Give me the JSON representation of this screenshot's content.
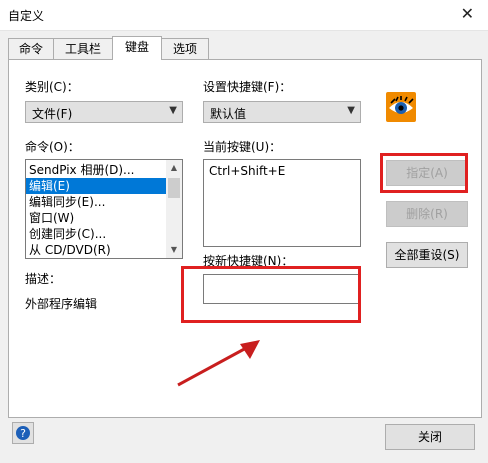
{
  "window": {
    "title": "自定义"
  },
  "tabs": [
    {
      "label": "命令"
    },
    {
      "label": "工具栏"
    },
    {
      "label": "键盘"
    },
    {
      "label": "选项"
    }
  ],
  "category": {
    "label": "类别(C)：",
    "value": "文件(F)"
  },
  "shortcut_set": {
    "label": "设置快捷键(F)：",
    "value": "默认值"
  },
  "commands": {
    "label": "命令(O)：",
    "items": [
      {
        "label": "SendPix 相册(D)..."
      },
      {
        "label": "编辑(E)"
      },
      {
        "label": "编辑同步(E)..."
      },
      {
        "label": "窗口(W)"
      },
      {
        "label": "创建同步(C)..."
      },
      {
        "label": "从 CD/DVD(R)"
      }
    ],
    "selected_index": 1
  },
  "current_keys": {
    "label": "当前按键(U)：",
    "value": "Ctrl+Shift+E"
  },
  "new_shortcut": {
    "label": "按新快捷键(N)：",
    "value": ""
  },
  "description": {
    "label": "描述：",
    "value": "外部程序编辑"
  },
  "buttons": {
    "assign": "指定(A)",
    "delete": "删除(R)",
    "reset_all": "全部重设(S)",
    "close": "关闭"
  },
  "colors": {
    "highlight": "#e02020",
    "arrow": "#c81e1e",
    "selection": "#0078d7"
  },
  "icons": {
    "app": "eye-logo-icon",
    "help": "help-icon"
  }
}
